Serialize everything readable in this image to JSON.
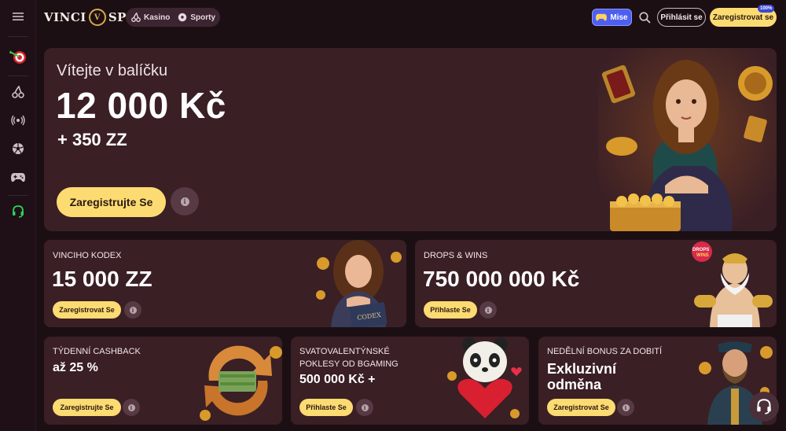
{
  "header": {
    "logo_left": "VINCI",
    "logo_right": "SPIN",
    "logo_mark": "V",
    "nav": [
      {
        "label": "Kasino",
        "icon": "cherries-icon"
      },
      {
        "label": "Sporty",
        "icon": "soccer-ball-icon"
      }
    ],
    "mise_label": "Mise",
    "login_label": "Přihlásit se",
    "register_label": "Zaregistrovat se",
    "register_badge": "100%"
  },
  "sidebar": {
    "items": [
      {
        "icon": "menu-icon"
      },
      {
        "icon": "dart-target-icon"
      },
      {
        "icon": "cherries-icon"
      },
      {
        "icon": "live-broadcast-icon"
      },
      {
        "icon": "soccer-ball-icon"
      },
      {
        "icon": "gamepad-icon"
      },
      {
        "icon": "headset-icon"
      }
    ]
  },
  "hero": {
    "welcome": "Vítejte v balíčku",
    "amount": "12 000 Kč",
    "bonus": "+ 350 ZZ",
    "cta": "Zaregistrujte Se",
    "info": "i"
  },
  "cards": {
    "kodex": {
      "title": "VINCIHO KODEX",
      "value": "15 000 ZZ",
      "button": "Zaregistrovat Se",
      "art_label": "CODEX"
    },
    "drops": {
      "title": "DROPS & WINS",
      "value": "750 000 000 Kč",
      "button": "Přihlaste Se",
      "art_label": "DROPS & WINS"
    },
    "cashback": {
      "title": "TÝDENNÍ CASHBACK",
      "value": "až 25 %",
      "button": "Zaregistrujte Se"
    },
    "valentine": {
      "title_line1": "SVATOVALENTÝNSKÉ",
      "title_line2": "POKLESY OD BGAMING",
      "value": "500 000 Kč +",
      "button": "Přihlaste Se"
    },
    "sunday": {
      "title": "NEDĚLNÍ BONUS ZA DOBITÍ",
      "value_line1": "Exkluzivní",
      "value_line2": "odměna",
      "button": "Zaregistrovat Se"
    }
  },
  "colors": {
    "background": "#1b0f14",
    "card": "#3a1f25",
    "accent_yellow": "#fcdb72",
    "mise_blue": "#4e5ff0"
  }
}
